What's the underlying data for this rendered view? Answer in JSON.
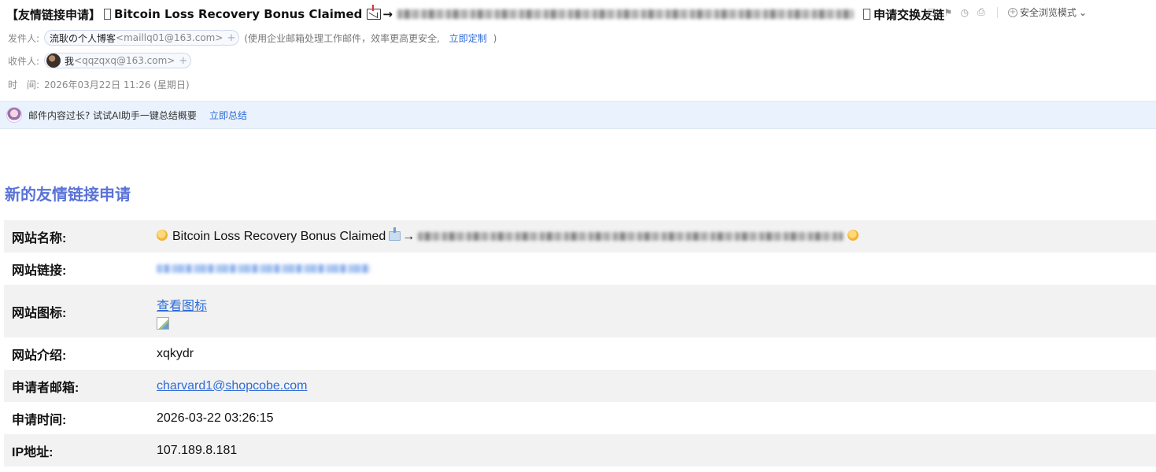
{
  "email": {
    "subject_prefix": "【友情链接申请】",
    "subject_text": "Bitcoin Loss Recovery Bonus Claimed",
    "arrow": "→",
    "subject_suffix": "申请交换友链",
    "toolbar": {
      "icons": [
        "bookmark-icon",
        "flag-icon",
        "clock-icon",
        "print-icon"
      ],
      "safe_mode_label": "安全浏览模式"
    },
    "from": {
      "label": "发件人:",
      "name": "流耿の个人博客",
      "address": "<maillq01@163.com>",
      "hint": "(使用企业邮箱处理工作邮件，效率更高更安全,",
      "hint_link": "立即定制",
      "hint_end": ")"
    },
    "to": {
      "label": "收件人:",
      "name": "我",
      "address": "<qqzqxq@163.com>"
    },
    "time": {
      "label": "时　间:",
      "value": "2026年03月22日 11:26 (星期日)"
    },
    "ai_bar": {
      "text": "邮件内容过长? 试试AI助手一键总结概要",
      "link": "立即总结"
    }
  },
  "body": {
    "title": "新的友情链接申请",
    "rows": {
      "site_name": {
        "label": "网站名称:",
        "text": "Bitcoin Loss Recovery Bonus Claimed",
        "arrow": "→"
      },
      "site_link": {
        "label": "网站链接:"
      },
      "site_icon": {
        "label": "网站图标:",
        "link": "查看图标"
      },
      "site_intro": {
        "label": "网站介绍:",
        "value": "xqkydr"
      },
      "email": {
        "label": "申请者邮箱:",
        "value": "charvard1@shopcobe.com"
      },
      "time": {
        "label": "申请时间:",
        "value": "2026-03-22 03:26:15"
      },
      "ip": {
        "label": "IP地址:",
        "value": "107.189.8.181"
      }
    }
  },
  "colors": {
    "title": "#5a73d8",
    "link": "#2f6bd8",
    "ai_bar_bg": "#eaf2fd",
    "row_alt_bg": "#f2f2f2"
  }
}
